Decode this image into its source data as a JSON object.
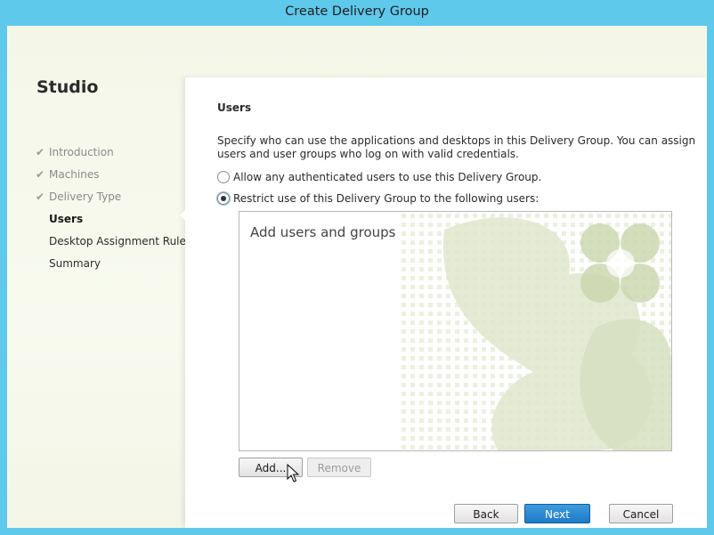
{
  "window": {
    "title": "Create Delivery Group"
  },
  "sidebar": {
    "title": "Studio",
    "steps": [
      {
        "label": "Introduction",
        "completed": true
      },
      {
        "label": "Machines",
        "completed": true
      },
      {
        "label": "Delivery Type",
        "completed": true
      },
      {
        "label": "Users",
        "current": true
      },
      {
        "label": "Desktop Assignment Rules"
      },
      {
        "label": "Summary"
      }
    ]
  },
  "main": {
    "heading": "Users",
    "description": "Specify who can use the applications and desktops in this Delivery Group. You can assign users and user groups who log on with valid credentials.",
    "options": [
      {
        "label": "Allow any authenticated users to use this Delivery Group.",
        "selected": false
      },
      {
        "label": "Restrict use of this Delivery Group to the following users:",
        "selected": true
      }
    ],
    "users_list": {
      "placeholder": "Add users and groups"
    },
    "add_label": "Add...",
    "remove_label": "Remove"
  },
  "footer": {
    "back_label": "Back",
    "next_label": "Next",
    "cancel_label": "Cancel"
  },
  "colors": {
    "title_bar": "#5fc9ec",
    "primary_button": "#2a8ad5",
    "watermark": "#dfe6cc"
  }
}
